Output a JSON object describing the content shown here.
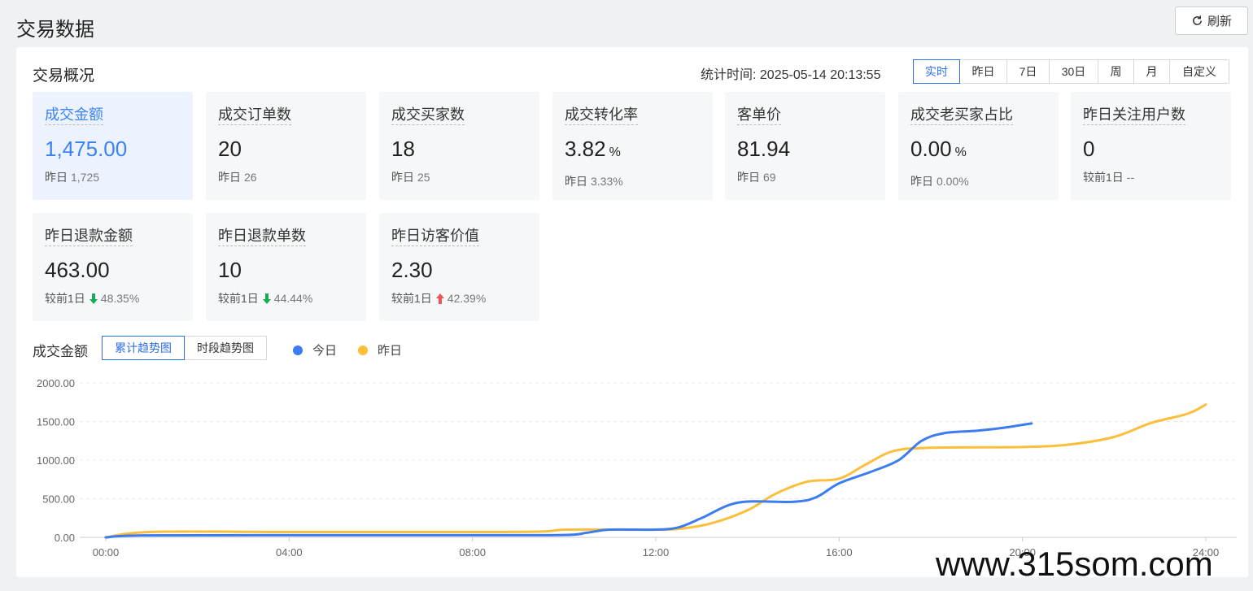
{
  "header": {
    "title": "交易数据",
    "refresh_label": "刷新"
  },
  "overview": {
    "title": "交易概况",
    "stat_time_label": "统计时间:",
    "stat_time_value": "2025-05-14 20:13:55",
    "ranges": [
      "实时",
      "昨日",
      "7日",
      "30日",
      "周",
      "月",
      "自定义"
    ],
    "active_range": "实时"
  },
  "cards": [
    {
      "label": "成交金额",
      "value": "1,475.00",
      "unit": "",
      "sub_label": "昨日",
      "sub_value": "1,725",
      "trend": ""
    },
    {
      "label": "成交订单数",
      "value": "20",
      "unit": "",
      "sub_label": "昨日",
      "sub_value": "26",
      "trend": ""
    },
    {
      "label": "成交买家数",
      "value": "18",
      "unit": "",
      "sub_label": "昨日",
      "sub_value": "25",
      "trend": ""
    },
    {
      "label": "成交转化率",
      "value": "3.82",
      "unit": "%",
      "sub_label": "昨日",
      "sub_value": "3.33%",
      "trend": ""
    },
    {
      "label": "客单价",
      "value": "81.94",
      "unit": "",
      "sub_label": "昨日",
      "sub_value": "69",
      "trend": ""
    },
    {
      "label": "成交老买家占比",
      "value": "0.00",
      "unit": "%",
      "sub_label": "昨日",
      "sub_value": "0.00%",
      "trend": ""
    },
    {
      "label": "昨日关注用户数",
      "value": "0",
      "unit": "",
      "sub_label": "较前1日",
      "sub_value": "--",
      "trend": ""
    },
    {
      "label": "昨日退款金额",
      "value": "463.00",
      "unit": "",
      "sub_label": "较前1日",
      "sub_value": "48.35%",
      "trend": "down"
    },
    {
      "label": "昨日退款单数",
      "value": "10",
      "unit": "",
      "sub_label": "较前1日",
      "sub_value": "44.44%",
      "trend": "down"
    },
    {
      "label": "昨日访客价值",
      "value": "2.30",
      "unit": "",
      "sub_label": "较前1日",
      "sub_value": "42.39%",
      "trend": "up"
    }
  ],
  "chart_section": {
    "title": "成交金额",
    "tabs": [
      "累计趋势图",
      "时段趋势图"
    ],
    "active_tab": "累计趋势图"
  },
  "colors": {
    "accent": "#2d6fe8",
    "today": "#3b7cf0",
    "yesterday": "#fbbf3c",
    "down": "#1aaa55",
    "up": "#f0534e"
  },
  "chart_data": {
    "type": "line",
    "x_ticks": [
      "00:00",
      "04:00",
      "08:00",
      "12:00",
      "16:00",
      "20:00",
      "24:00"
    ],
    "y_ticks": [
      "0.00",
      "500.00",
      "1000.00",
      "1500.00",
      "2000.00"
    ],
    "ylim": [
      0,
      2000
    ],
    "xlim": [
      0,
      24
    ],
    "grid": true,
    "legend_position": "top-left",
    "series": [
      {
        "name": "今日",
        "color": "#3b7cf0",
        "points": [
          [
            0,
            0
          ],
          [
            0.8,
            25
          ],
          [
            4,
            28
          ],
          [
            8,
            28
          ],
          [
            10,
            30
          ],
          [
            10.5,
            60
          ],
          [
            11,
            100
          ],
          [
            12,
            100
          ],
          [
            12.5,
            130
          ],
          [
            13,
            250
          ],
          [
            13.8,
            450
          ],
          [
            15,
            460
          ],
          [
            15.5,
            520
          ],
          [
            16,
            700
          ],
          [
            16.7,
            850
          ],
          [
            17.3,
            1000
          ],
          [
            17.8,
            1250
          ],
          [
            18.3,
            1350
          ],
          [
            19,
            1380
          ],
          [
            19.6,
            1420
          ],
          [
            20.2,
            1475
          ]
        ]
      },
      {
        "name": "昨日",
        "color": "#fbbf3c",
        "points": [
          [
            0,
            0
          ],
          [
            1,
            70
          ],
          [
            4,
            70
          ],
          [
            8,
            70
          ],
          [
            9.5,
            75
          ],
          [
            10,
            100
          ],
          [
            11,
            100
          ],
          [
            12,
            100
          ],
          [
            12.5,
            110
          ],
          [
            13.2,
            180
          ],
          [
            14,
            350
          ],
          [
            14.6,
            560
          ],
          [
            15.3,
            720
          ],
          [
            16,
            760
          ],
          [
            16.6,
            950
          ],
          [
            17.2,
            1120
          ],
          [
            18,
            1160
          ],
          [
            20,
            1170
          ],
          [
            21,
            1200
          ],
          [
            22,
            1300
          ],
          [
            22.8,
            1480
          ],
          [
            23.6,
            1600
          ],
          [
            24,
            1720
          ]
        ]
      }
    ]
  },
  "watermark": "www.315som.com"
}
